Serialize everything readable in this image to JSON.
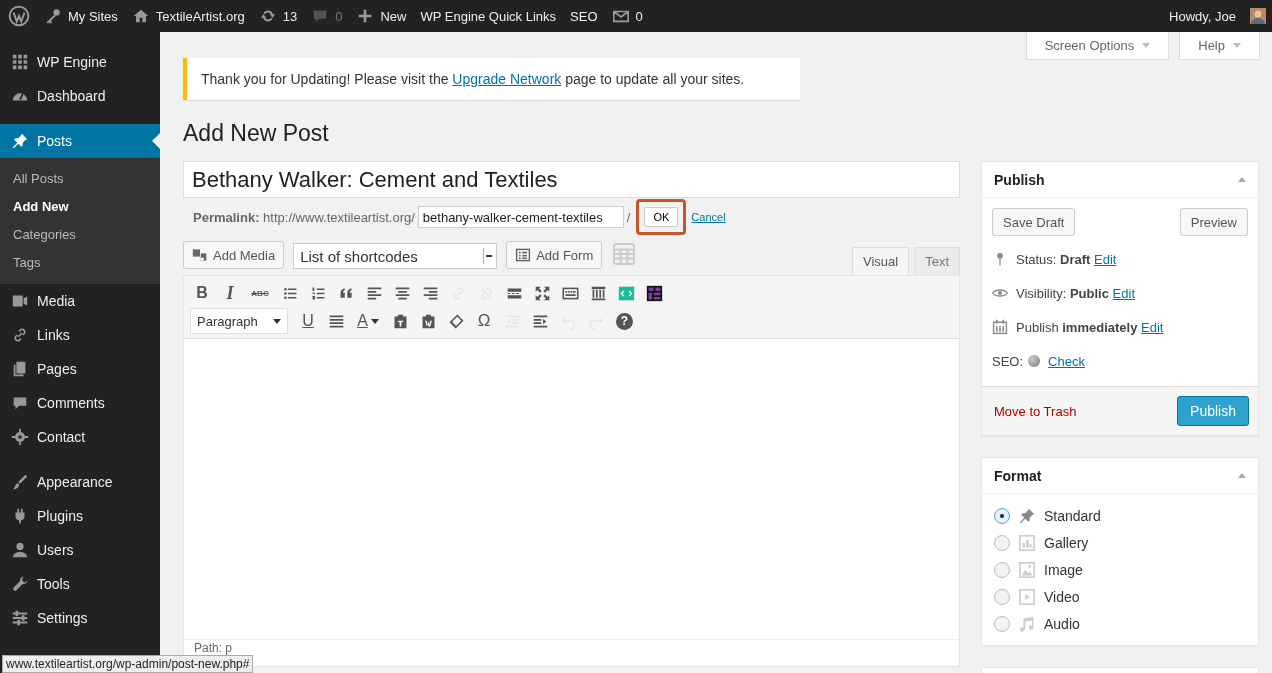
{
  "admin_bar": {
    "items": [
      {
        "kind": "logo",
        "disabled": false
      },
      {
        "kind": "key",
        "label": "My Sites",
        "disabled": false
      },
      {
        "kind": "home",
        "label": "TextileArtist.org",
        "disabled": false
      },
      {
        "kind": "refresh",
        "label": "13",
        "disabled": false
      },
      {
        "kind": "bubble",
        "label": "0",
        "disabled": true
      },
      {
        "kind": "plus",
        "label": "New",
        "disabled": false
      },
      {
        "kind": "text",
        "label": "WP Engine Quick Links",
        "disabled": false
      },
      {
        "kind": "text",
        "label": "SEO",
        "disabled": false
      },
      {
        "kind": "mail",
        "label": "0",
        "disabled": false
      }
    ],
    "greeting": "Howdy, Joe"
  },
  "screen_meta": [
    {
      "label": "Screen Options"
    },
    {
      "label": "Help"
    }
  ],
  "sidebar": {
    "groups": [
      [
        {
          "kind": "grid",
          "label": "WP Engine",
          "selected": false
        },
        {
          "kind": "gauge",
          "label": "Dashboard",
          "selected": false
        }
      ],
      [
        {
          "kind": "pushpin",
          "label": "Posts",
          "selected": true,
          "children": [
            {
              "label": "All Posts",
              "selected": false
            },
            {
              "label": "Add New",
              "selected": true
            },
            {
              "label": "Categories",
              "selected": false
            },
            {
              "label": "Tags",
              "selected": false
            }
          ]
        },
        {
          "kind": "media",
          "label": "Media",
          "selected": false
        },
        {
          "kind": "link",
          "label": "Links",
          "selected": false
        },
        {
          "kind": "pages",
          "label": "Pages",
          "selected": false
        },
        {
          "kind": "bubble",
          "label": "Comments",
          "selected": false
        },
        {
          "kind": "gear",
          "label": "Contact",
          "selected": false
        }
      ],
      [
        {
          "kind": "brush",
          "label": "Appearance",
          "selected": false
        },
        {
          "kind": "plug",
          "label": "Plugins",
          "selected": false
        },
        {
          "kind": "user",
          "label": "Users",
          "selected": false
        },
        {
          "kind": "wrench",
          "label": "Tools",
          "selected": false
        },
        {
          "kind": "sliders",
          "label": "Settings",
          "selected": false
        }
      ]
    ]
  },
  "notice": {
    "before": "Thank you for Updating! Please visit the",
    "link": "Upgrade Network",
    "after": "page to update all your sites."
  },
  "heading": "Add New Post",
  "title_field": {
    "value": "Bethany Walker: Cement and Textiles"
  },
  "permalink": {
    "label": "Permalink:",
    "base": "http://www.textileartist.org/",
    "slug": "bethany-walker-cement-textiles",
    "separator": "/",
    "ok": "OK",
    "ok_highlighted": true,
    "cancel": "Cancel"
  },
  "media_buttons": [
    {
      "kind": "add-media",
      "label": "Add Media"
    },
    {
      "kind": "select",
      "label": "List of shortcodes"
    },
    {
      "kind": "add-form",
      "label": "Add Form"
    },
    {
      "kind": "table"
    }
  ],
  "editor_tabs": [
    {
      "label": "Visual",
      "selected": true
    },
    {
      "label": "Text",
      "selected": false
    }
  ],
  "toolbar_rows": [
    [
      {
        "kind": "bold",
        "label": "B",
        "disabled": false
      },
      {
        "kind": "italic",
        "label": "I",
        "disabled": false
      },
      {
        "kind": "strike",
        "label": "ABC",
        "disabled": false
      },
      {
        "kind": "ul",
        "disabled": false
      },
      {
        "kind": "ol",
        "disabled": false
      },
      {
        "kind": "quote",
        "disabled": false
      },
      {
        "kind": "align-left",
        "disabled": false
      },
      {
        "kind": "align-center",
        "disabled": false
      },
      {
        "kind": "align-right",
        "disabled": false
      },
      {
        "kind": "link",
        "disabled": true
      },
      {
        "kind": "unlink",
        "disabled": true
      },
      {
        "kind": "more",
        "disabled": false
      },
      {
        "kind": "fullscreen",
        "disabled": false
      },
      {
        "kind": "keyboard",
        "disabled": false
      },
      {
        "kind": "columns",
        "disabled": false
      },
      {
        "kind": "code",
        "disabled": false
      },
      {
        "kind": "table-grid",
        "disabled": false
      }
    ],
    [
      {
        "kind": "format",
        "label": "Paragraph",
        "disabled": false
      },
      {
        "kind": "underline",
        "label": "U",
        "disabled": false
      },
      {
        "kind": "justify",
        "disabled": false
      },
      {
        "kind": "text-color",
        "label": "A",
        "disabled": false
      },
      {
        "kind": "paste-text",
        "disabled": false
      },
      {
        "kind": "paste-word",
        "disabled": false
      },
      {
        "kind": "eraser",
        "disabled": false
      },
      {
        "kind": "omega",
        "label": "Ω",
        "disabled": false
      },
      {
        "kind": "outdent",
        "disabled": true
      },
      {
        "kind": "indent",
        "disabled": false
      },
      {
        "kind": "undo",
        "disabled": true
      },
      {
        "kind": "redo",
        "disabled": true
      },
      {
        "kind": "help",
        "label": "?",
        "disabled": false
      }
    ]
  ],
  "editor_path": "Path: p",
  "publish_box": {
    "title": "Publish",
    "save_draft": "Save Draft",
    "preview": "Preview",
    "rows": [
      {
        "kind": "map-pin",
        "text": "Status: **Draft**",
        "link": "Edit"
      },
      {
        "kind": "eye",
        "text": "Visibility: **Public**",
        "link": "Edit"
      },
      {
        "kind": "calendar",
        "text": "Publish **immediately**",
        "link": "Edit"
      }
    ],
    "seo": {
      "label": "SEO:",
      "link": "Check"
    },
    "trash": "Move to Trash",
    "publish": "Publish"
  },
  "format_box": {
    "title": "Format",
    "options": [
      {
        "kind": "pushpin",
        "label": "Standard",
        "selected": true
      },
      {
        "kind": "gallery",
        "label": "Gallery",
        "selected": false
      },
      {
        "kind": "image",
        "label": "Image",
        "selected": false
      },
      {
        "kind": "video",
        "label": "Video",
        "selected": false
      },
      {
        "kind": "note",
        "label": "Audio",
        "selected": false
      }
    ]
  },
  "status_url": "www.textileartist.org/wp-admin/post-new.php#"
}
